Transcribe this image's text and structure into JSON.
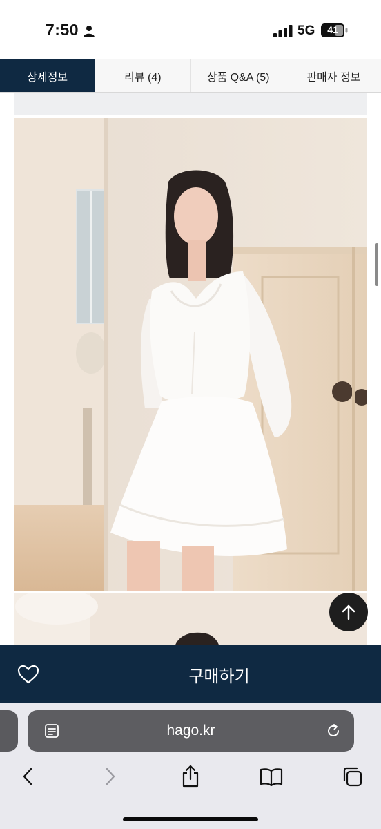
{
  "status_bar": {
    "time": "7:50",
    "network": "5G",
    "battery": "41"
  },
  "tabs": [
    {
      "label": "상세정보",
      "active": true
    },
    {
      "label": "리뷰 (4)",
      "active": false
    },
    {
      "label": "상품 Q&A (5)",
      "active": false
    },
    {
      "label": "판매자 정보",
      "active": false
    }
  ],
  "purchase_bar": {
    "buy_label": "구매하기",
    "wishlist_icon": "heart-icon"
  },
  "browser": {
    "url": "hago.kr",
    "toolbar_icons": [
      "back-icon",
      "forward-icon",
      "share-icon",
      "bookmarks-icon",
      "tabs-icon"
    ]
  },
  "colors": {
    "brand_navy": "#0f2942",
    "address_bar": "#5d5d61",
    "chrome_bg": "#e9e9ee"
  }
}
